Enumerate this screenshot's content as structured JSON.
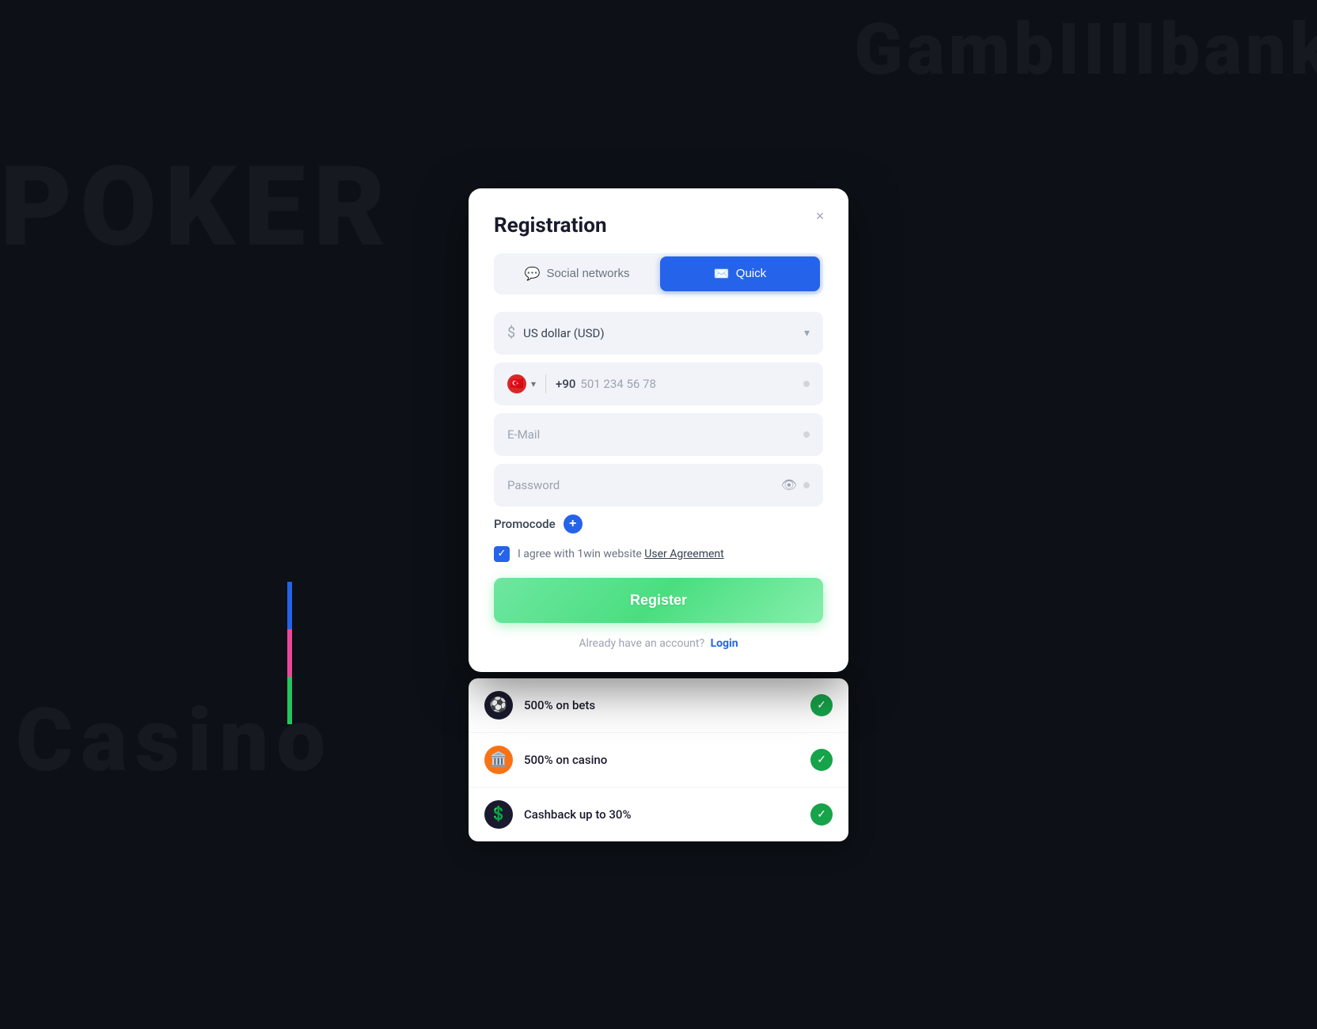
{
  "background": {
    "text_poker": "POKER",
    "text_casino": "Casino",
    "text_brand": "GambIIIIbank"
  },
  "modal": {
    "title": "Registration",
    "close_label": "×",
    "tabs": [
      {
        "id": "social",
        "label": "Social networks",
        "icon": "💬",
        "active": false
      },
      {
        "id": "quick",
        "label": "Quick",
        "icon": "✉️",
        "active": true
      }
    ],
    "currency_field": {
      "placeholder": "US dollar (USD)",
      "icon": "$"
    },
    "phone_field": {
      "country_code": "+90",
      "country_flag": "🇹🇷",
      "placeholder": "501 234 56 78"
    },
    "email_field": {
      "placeholder": "E-Mail"
    },
    "password_field": {
      "placeholder": "Password"
    },
    "promocode": {
      "label": "Promocode",
      "add_label": "+"
    },
    "agreement": {
      "text": "I agree with 1win website ",
      "link_text": "User Agreement",
      "checked": true
    },
    "register_button": "Register",
    "login_text": "Already have an account?",
    "login_link": "Login"
  },
  "promotions": [
    {
      "id": "bets",
      "icon": "⚽",
      "icon_bg": "soccer",
      "text": "500% on bets"
    },
    {
      "id": "casino",
      "icon": "🏛️",
      "icon_bg": "casino",
      "text": "500% on casino"
    },
    {
      "id": "cashback",
      "icon": "💲",
      "icon_bg": "cashback",
      "text": "Cashback up to 30%"
    }
  ]
}
